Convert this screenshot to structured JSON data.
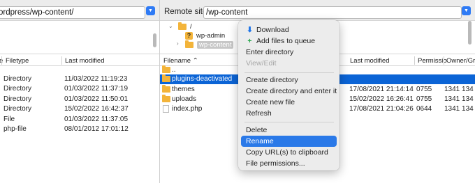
{
  "local": {
    "path": "ordpress/wp-content/",
    "columns": [
      "e",
      "Filetype",
      "Last modified"
    ],
    "files": [
      {
        "filetype": "Directory",
        "modified": "11/03/2022 11:19:23"
      },
      {
        "filetype": "Directory",
        "modified": "01/03/2022 11:37:19"
      },
      {
        "filetype": "Directory",
        "modified": "01/03/2022 11:50:01"
      },
      {
        "filetype": "Directory",
        "modified": "15/02/2022 16:42:37"
      },
      {
        "filetype": "File",
        "modified": "01/03/2022 11:37:05"
      },
      {
        "filetype": "php-file",
        "modified": "08/01/2012 17:01:12"
      }
    ]
  },
  "remote": {
    "site_label": "Remote site:",
    "path": "/wp-content",
    "tree": [
      {
        "label": "/"
      },
      {
        "label": "wp-admin"
      },
      {
        "label": "wp-content"
      }
    ],
    "columns": {
      "filename": "Filename",
      "sort_arrow": "^",
      "last_modified": "Last modified",
      "permissions": "Permissio",
      "owner": "Owner/Gro"
    },
    "files": [
      {
        "name": "..",
        "modified": "",
        "perms": "",
        "owner": ""
      },
      {
        "name": "plugins-deactivated",
        "modified": "",
        "perms": "",
        "owner": ""
      },
      {
        "name": "themes",
        "modified": "17/08/2021 21:14:14",
        "perms": "0755",
        "owner": "1341 134"
      },
      {
        "name": "uploads",
        "modified": "15/02/2022 16:26:41",
        "perms": "0755",
        "owner": "1341 134"
      },
      {
        "name": "index.php",
        "modified": "17/08/2021 21:04:26",
        "perms": "0644",
        "owner": "1341 134"
      }
    ]
  },
  "context_menu": {
    "items": [
      {
        "label": "Download",
        "icon": "download-arrow-icon",
        "glyph": "⬇"
      },
      {
        "label": "Add files to queue",
        "icon": "add-to-queue-icon",
        "glyph": "+"
      },
      {
        "label": "Enter directory"
      },
      {
        "label": "View/Edit",
        "disabled": true
      },
      {
        "label": "Create directory"
      },
      {
        "label": "Create directory and enter it"
      },
      {
        "label": "Create new file"
      },
      {
        "label": "Refresh"
      },
      {
        "label": "Delete"
      },
      {
        "label": "Rename",
        "highlighted": true
      },
      {
        "label": "Copy URL(s) to clipboard"
      },
      {
        "label": "File permissions..."
      }
    ]
  },
  "colors": {
    "selection": "#0b64d6",
    "menu_highlight": "#2a79e8",
    "folder": "#f3b43a",
    "dropdown_button": "#2f7bf5"
  }
}
